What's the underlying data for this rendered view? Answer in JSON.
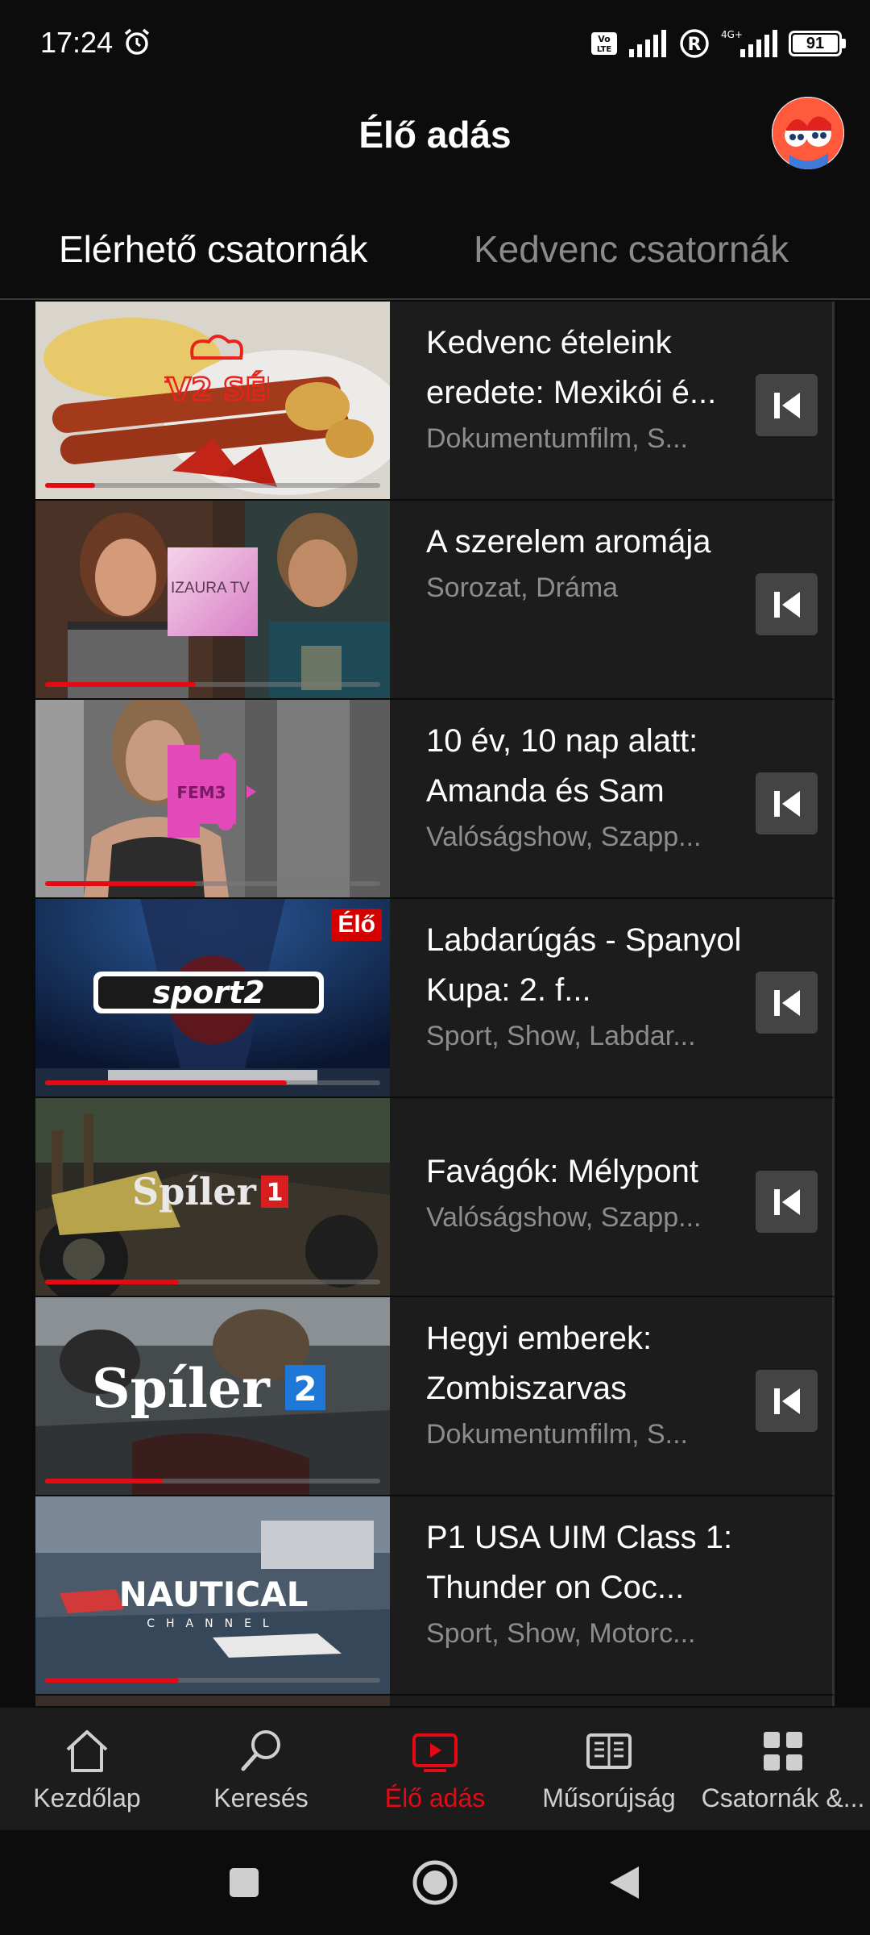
{
  "status_bar": {
    "time": "17:24",
    "battery": "91"
  },
  "header": {
    "title": "Élő adás"
  },
  "tabs": [
    {
      "label": "Elérhető csatornák",
      "active": true
    },
    {
      "label": "Kedvenc csatornák",
      "active": false
    }
  ],
  "channels": [
    {
      "logo": "TV2 SÉF",
      "title": "Kedvenc ételeink eredete: Mexikói é...",
      "genre": "Dokumentumfilm, S...",
      "progress": 0.15,
      "live": false,
      "restart": true
    },
    {
      "logo": "IZAURA TV",
      "title": "A szerelem aromája",
      "genre": "Sorozat, Dráma",
      "progress": 0.45,
      "live": false,
      "restart": true
    },
    {
      "logo": "FEM3",
      "title": "10 év, 10 nap alatt: Amanda és Sam",
      "genre": "Valóságshow, Szapp...",
      "progress": 0.45,
      "live": false,
      "restart": true
    },
    {
      "logo": "sport2",
      "title": "Labdarúgás - Spanyol Kupa: 2. f...",
      "genre": "Sport, Show, Labdar...",
      "progress": 0.72,
      "live": true,
      "live_label": "Élő",
      "restart": true
    },
    {
      "logo": "Spíler1",
      "title": "Favágók: Mélypont",
      "genre": "Valóságshow, Szapp...",
      "progress": 0.4,
      "live": false,
      "restart": true
    },
    {
      "logo": "Spíler2",
      "title": "Hegyi emberek: Zombiszarvas",
      "genre": "Dokumentumfilm, S...",
      "progress": 0.35,
      "live": false,
      "restart": true
    },
    {
      "logo": "NAUTICAL",
      "logo_sub": "CHANNEL",
      "title": "P1 USA UIM Class 1: Thunder on Coc...",
      "genre": "Sport, Show, Motorc...",
      "progress": 0.4,
      "live": false,
      "restart": false
    }
  ],
  "bottom_nav": [
    {
      "label": "Kezdőlap",
      "icon": "home-icon",
      "active": false
    },
    {
      "label": "Keresés",
      "icon": "search-icon",
      "active": false
    },
    {
      "label": "Élő adás",
      "icon": "live-tv-icon",
      "active": true
    },
    {
      "label": "Műsorújság",
      "icon": "tv-guide-icon",
      "active": false
    },
    {
      "label": "Csatornák &...",
      "icon": "channels-grid-icon",
      "active": false
    }
  ],
  "colors": {
    "accent": "#e50914",
    "background": "#0c0c0c",
    "row": "#1c1c1c",
    "muted": "#8c8c8c"
  }
}
